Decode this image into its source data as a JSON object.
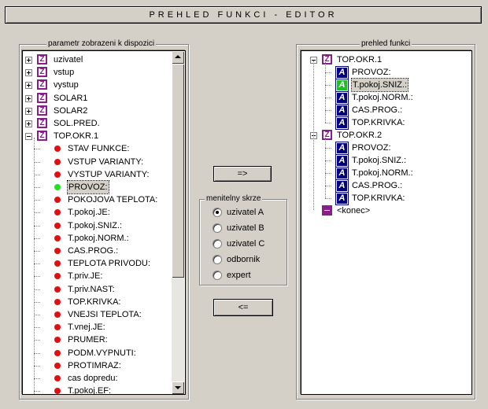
{
  "title": "PREHLED FUNKCI - EDITOR",
  "left_group": {
    "label": "parametr zobrazeni k dispozici",
    "roots": [
      {
        "label": "uzivatel",
        "expanded": false
      },
      {
        "label": "vstup",
        "expanded": false
      },
      {
        "label": "vystup",
        "expanded": false
      },
      {
        "label": "SOLAR1",
        "expanded": false
      },
      {
        "label": "SOLAR2",
        "expanded": false
      },
      {
        "label": "SOL.PRED.",
        "expanded": false
      },
      {
        "label": "TOP.OKR.1",
        "expanded": true
      }
    ],
    "children": [
      {
        "label": "STAV FUNKCE:",
        "status": "red"
      },
      {
        "label": "VSTUP VARIANTY:",
        "status": "red"
      },
      {
        "label": "VYSTUP VARIANTY:",
        "status": "red"
      },
      {
        "label": "PROVOZ:",
        "status": "green",
        "selected": true
      },
      {
        "label": "POKOJOVA TEPLOTA:",
        "status": "red"
      },
      {
        "label": "T.pokoj.JE:",
        "status": "red"
      },
      {
        "label": "T.pokoj.SNIZ.:",
        "status": "red"
      },
      {
        "label": "T.pokoj.NORM.:",
        "status": "red"
      },
      {
        "label": "CAS.PROG.:",
        "status": "red"
      },
      {
        "label": "TEPLOTA PRIVODU:",
        "status": "red"
      },
      {
        "label": "T.priv.JE:",
        "status": "red"
      },
      {
        "label": "T.priv.NAST:",
        "status": "red"
      },
      {
        "label": "TOP.KRIVKA:",
        "status": "red"
      },
      {
        "label": "VNEJSI TEPLOTA:",
        "status": "red"
      },
      {
        "label": "T.vnej.JE:",
        "status": "red"
      },
      {
        "label": "PRUMER:",
        "status": "red"
      },
      {
        "label": "PODM.VYPNUTI:",
        "status": "red"
      },
      {
        "label": "PROTIMRAZ:",
        "status": "red"
      },
      {
        "label": "cas dopredu:",
        "status": "red"
      },
      {
        "label": "T.pokoj.EF:",
        "status": "red"
      }
    ]
  },
  "buttons": {
    "add": "=>",
    "remove": "<="
  },
  "radio_group": {
    "label": "menitelny skrze",
    "options": [
      {
        "label": "uzivatel A",
        "checked": true
      },
      {
        "label": "uzivatel B",
        "checked": false
      },
      {
        "label": "uzivatel C",
        "checked": false
      },
      {
        "label": "odbornik",
        "checked": false
      },
      {
        "label": "expert",
        "checked": false
      }
    ]
  },
  "right_group": {
    "label": "prehled funkci",
    "tree": [
      {
        "label": "TOP.OKR.1",
        "children": [
          {
            "label": "PROVOZ:",
            "icon": "blue"
          },
          {
            "label": "T.pokoj.SNIZ.:",
            "icon": "green",
            "selected": true
          },
          {
            "label": "T.pokoj.NORM.:",
            "icon": "blue"
          },
          {
            "label": "CAS.PROG.:",
            "icon": "blue"
          },
          {
            "label": "TOP.KRIVKA:",
            "icon": "blue"
          }
        ]
      },
      {
        "label": "TOP.OKR.2",
        "children": [
          {
            "label": "PROVOZ:",
            "icon": "blue"
          },
          {
            "label": "T.pokoj.SNIZ.:",
            "icon": "blue"
          },
          {
            "label": "T.pokoj.NORM.:",
            "icon": "blue"
          },
          {
            "label": "CAS.PROG.:",
            "icon": "blue"
          },
          {
            "label": "TOP.KRIVKA:",
            "icon": "blue"
          }
        ]
      }
    ],
    "end_label": "<konec>"
  },
  "icon_letters": {
    "group": "Z",
    "param": "A"
  },
  "colors": {
    "group_icon": "#8b1c8b",
    "param_icon": "#000080",
    "selected_icon": "#20c020",
    "status_red": "#e01010",
    "status_green": "#20e020"
  }
}
